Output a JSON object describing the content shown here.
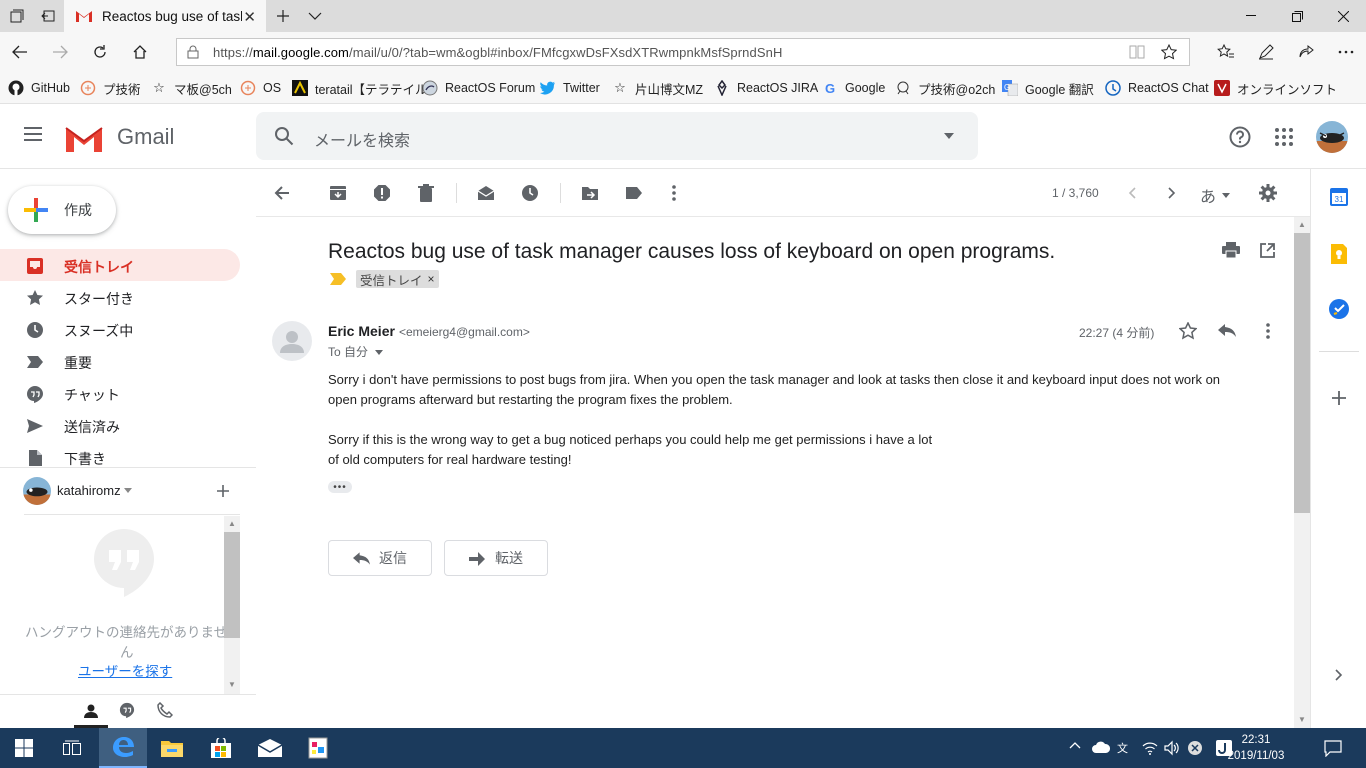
{
  "browser": {
    "tab_title": "Reactos bug use of task",
    "url_prefix": "https://",
    "url_domain": "mail.google.com",
    "url_rest": "/mail/u/0/?tab=wm&ogbl#inbox/FMfcgxwDsFXsdXTRwmpnkMsfSprndSnH"
  },
  "bookmarks": [
    {
      "label": "GitHub",
      "icon": "github-icon"
    },
    {
      "label": "プ技術",
      "icon": "site-icon"
    },
    {
      "label": "マ板@5ch",
      "icon": "star-outline-icon"
    },
    {
      "label": "OS",
      "icon": "site-icon"
    },
    {
      "label": "teratail【テラテイル】",
      "icon": "teratail-icon"
    },
    {
      "label": "ReactOS Forum",
      "icon": "reactos-icon"
    },
    {
      "label": "Twitter",
      "icon": "twitter-icon"
    },
    {
      "label": "片山博文MZ",
      "icon": "star-outline-icon"
    },
    {
      "label": "ReactOS JIRA",
      "icon": "jira-icon"
    },
    {
      "label": "Google",
      "icon": "google-icon"
    },
    {
      "label": "プ技術@o2ch",
      "icon": "o2ch-icon"
    },
    {
      "label": "Google 翻訳",
      "icon": "translate-icon"
    },
    {
      "label": "ReactOS Chat",
      "icon": "chat-icon"
    },
    {
      "label": "オンラインソフト",
      "icon": "vector-icon"
    }
  ],
  "gmail": {
    "product": "Gmail",
    "search_placeholder": "メールを検索",
    "compose_label": "作成",
    "nav": [
      {
        "label": "受信トレイ",
        "icon": "inbox-icon",
        "active": true
      },
      {
        "label": "スター付き",
        "icon": "star-icon"
      },
      {
        "label": "スヌーズ中",
        "icon": "clock-icon"
      },
      {
        "label": "重要",
        "icon": "important-icon"
      },
      {
        "label": "チャット",
        "icon": "chat-icon"
      },
      {
        "label": "送信済み",
        "icon": "send-icon"
      },
      {
        "label": "下書き",
        "icon": "draft-icon"
      }
    ],
    "hangouts": {
      "user": "katahiromz",
      "empty_text_1": "ハングアウトの連絡先がありませ",
      "empty_text_2": "ん",
      "find_link": "ユーザーを探す"
    },
    "pager": "1 / 3,760",
    "input_tool": "あ"
  },
  "message": {
    "subject": "Reactos bug use of task manager causes loss of keyboard on open programs.",
    "label": "受信トレイ",
    "label_remove": "×",
    "sender_name": "Eric Meier",
    "sender_email": "<emeierg4@gmail.com>",
    "to": "To 自分",
    "time": "22:27 (4 分前)",
    "body_1": "Sorry i don't have permissions to post bugs from jira.  When you open the task manager and look at tasks then close it  and keyboard input does not work on",
    "body_2": "open programs afterward but restarting the program fixes the problem.",
    "body_3": "Sorry if this is the wrong way to get a bug noticed perhaps you could help me get permissions i have a lot",
    "body_4": "of old computers for real hardware testing!",
    "reply_label": "返信",
    "forward_label": "転送"
  },
  "taskbar": {
    "time": "22:31",
    "date": "2019/11/03"
  },
  "colors": {
    "gmail_red": "#d93025",
    "inbox_active_bg": "#fce8e6",
    "taskbar": "#1b3a5c",
    "edge_blue": "#0078d7"
  }
}
